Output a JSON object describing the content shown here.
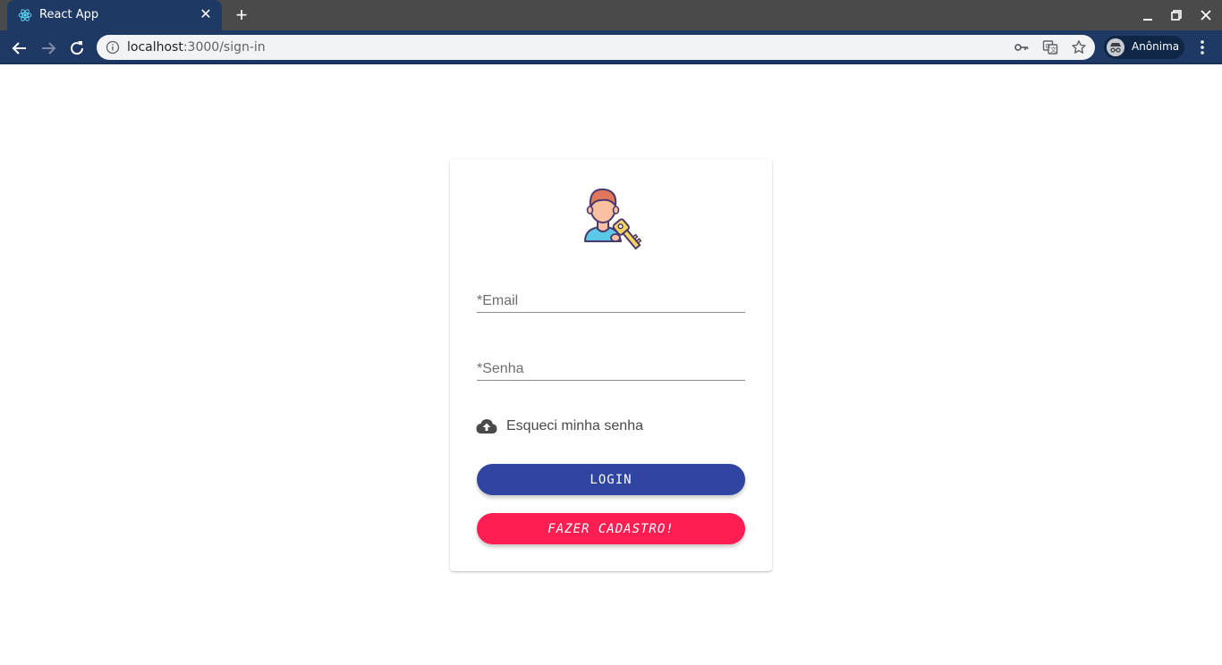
{
  "browser": {
    "tab_title": "React App",
    "url_host": "localhost",
    "url_path": ":3000/sign-in",
    "profile_label": "Anônima",
    "tab_bg": "#1e3a64",
    "titlebar_bg": "#4a4a4a"
  },
  "form": {
    "email_placeholder": "*Email",
    "senha_placeholder": "*Senha",
    "forgot_label": "Esqueci minha senha",
    "login_label": "LOGIN",
    "signup_label": "FAZER CADASTRO!",
    "login_color": "#3044a2",
    "signup_color": "#fe1e52"
  },
  "icons": {
    "favicon": "react-icon",
    "illustration": "user-key-icon",
    "forgot": "cloud-upload-icon"
  }
}
